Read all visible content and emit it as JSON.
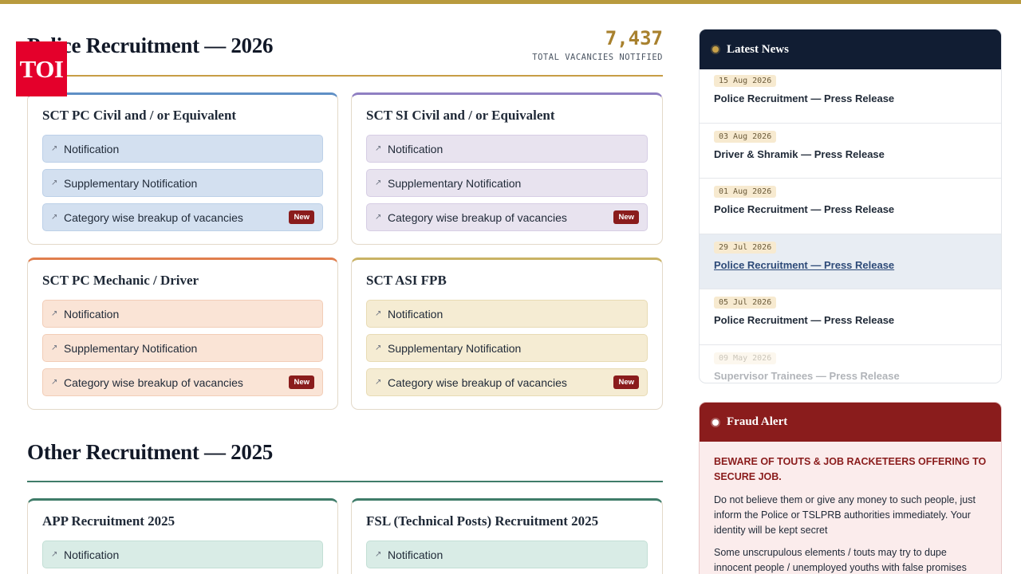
{
  "logo": {
    "text": "TOI"
  },
  "police": {
    "title": "Police Recruitment — 2026",
    "vacancies": "7,437",
    "vacancies_label": "TOTAL VACANCIES NOTIFIED",
    "cards": [
      {
        "title": "SCT PC Civil and / or Equivalent",
        "theme": "blue",
        "links": [
          {
            "label": "Notification"
          },
          {
            "label": "Supplementary Notification"
          },
          {
            "label": "Category wise breakup of vacancies",
            "badge": "New"
          }
        ]
      },
      {
        "title": "SCT SI Civil and / or Equivalent",
        "theme": "purple",
        "links": [
          {
            "label": "Notification"
          },
          {
            "label": "Supplementary Notification"
          },
          {
            "label": "Category wise breakup of vacancies",
            "badge": "New"
          }
        ]
      },
      {
        "title": "SCT PC Mechanic / Driver",
        "theme": "orange",
        "links": [
          {
            "label": "Notification"
          },
          {
            "label": "Supplementary Notification"
          },
          {
            "label": "Category wise breakup of vacancies",
            "badge": "New"
          }
        ]
      },
      {
        "title": "SCT ASI FPB",
        "theme": "gold",
        "links": [
          {
            "label": "Notification"
          },
          {
            "label": "Supplementary Notification"
          },
          {
            "label": "Category wise breakup of vacancies",
            "badge": "New"
          }
        ]
      }
    ]
  },
  "other": {
    "title": "Other Recruitment — 2025",
    "cards": [
      {
        "title": "APP Recruitment 2025",
        "links": [
          {
            "label": "Notification"
          }
        ]
      },
      {
        "title": "FSL (Technical Posts) Recruitment 2025",
        "links": [
          {
            "label": "Notification"
          }
        ]
      }
    ]
  },
  "news": {
    "heading": "Latest News",
    "items": [
      {
        "date": "15 Aug 2026",
        "title": "Police Recruitment — Press Release"
      },
      {
        "date": "03 Aug 2026",
        "title": "Driver & Shramik — Press Release"
      },
      {
        "date": "01 Aug 2026",
        "title": "Police Recruitment — Press Release"
      },
      {
        "date": "29 Jul 2026",
        "title": "Police Recruitment — Press Release"
      },
      {
        "date": "05 Jul 2026",
        "title": "Police Recruitment — Press Release"
      },
      {
        "date": "09 May 2026",
        "title": "Supervisor Trainees — Press Release"
      }
    ]
  },
  "fraud": {
    "heading": "Fraud Alert",
    "warning": "BEWARE OF TOUTS & JOB RACKETEERS OFFERING TO SECURE JOB.",
    "p1": "Do not believe them or give any money to such people, just inform the Police or TSLPRB authorities immediately. Your identity will be kept secret",
    "p2": "Some unscrupulous elements / touts may try to dupe innocent people / unemployed youths with false promises"
  },
  "icons": {
    "link_arrow": "arrow-up-right-icon",
    "news_dot": "bullet-dot-icon"
  },
  "colors": {
    "accent_gold": "#b89a3e",
    "navy": "#111d33",
    "fraud_red": "#8a1c1c",
    "logo_red": "#e4002b"
  }
}
